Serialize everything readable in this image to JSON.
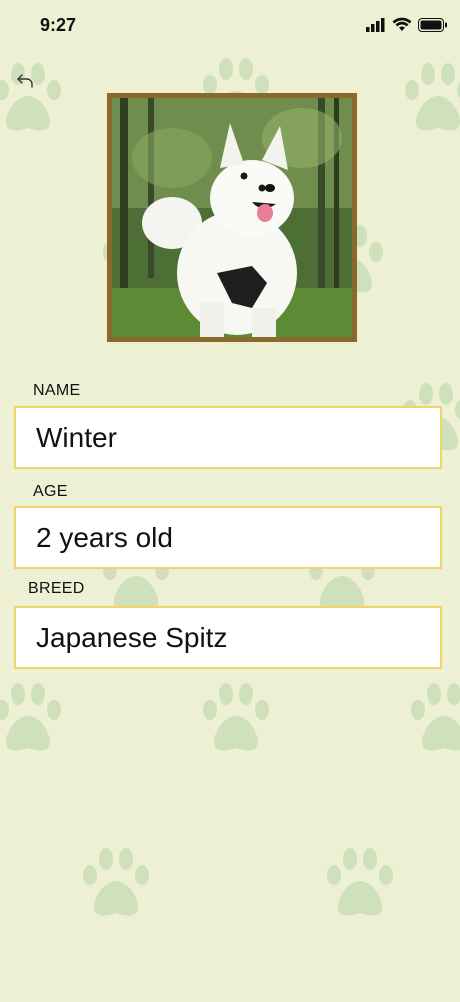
{
  "status_bar": {
    "time": "9:27"
  },
  "icons": {
    "back": "back-arrow-icon",
    "background": "paw-print-icon"
  },
  "photo": {
    "subject": "white Japanese Spitz dog in forest",
    "frame_color": "#8a6a2a"
  },
  "fields": {
    "name": {
      "label": "NAME",
      "value": "Winter"
    },
    "age": {
      "label": "AGE",
      "value": "2 years old"
    },
    "breed": {
      "label": "BREED",
      "value": "Japanese Spitz"
    }
  },
  "colors": {
    "background": "#eef0d3",
    "paw": "#cfe0bd",
    "field_border": "#f1d26c"
  }
}
